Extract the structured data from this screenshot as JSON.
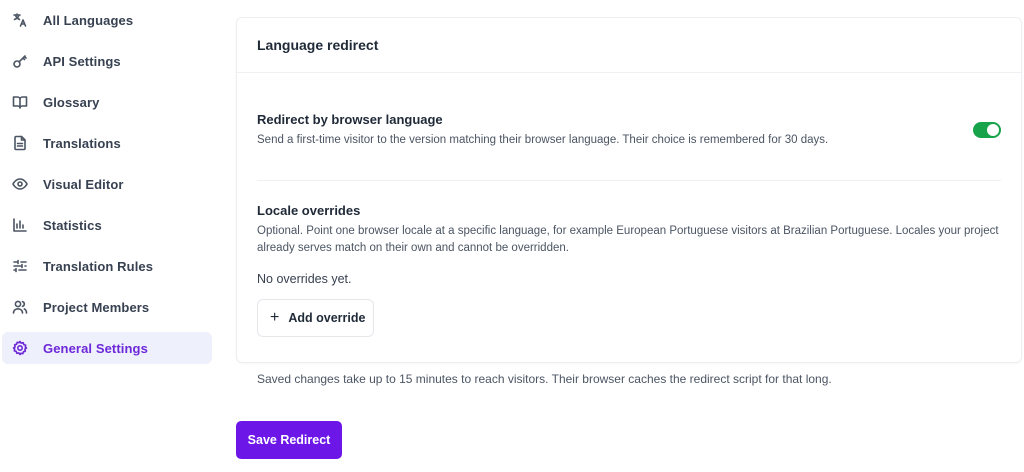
{
  "sidebar": {
    "items": [
      {
        "label": "All Languages",
        "icon": "translate-icon"
      },
      {
        "label": "API Settings",
        "icon": "key-icon"
      },
      {
        "label": "Glossary",
        "icon": "book-icon"
      },
      {
        "label": "Translations",
        "icon": "document-icon"
      },
      {
        "label": "Visual Editor",
        "icon": "eye-icon"
      },
      {
        "label": "Statistics",
        "icon": "bar-chart-icon"
      },
      {
        "label": "Translation Rules",
        "icon": "sliders-icon"
      },
      {
        "label": "Project Members",
        "icon": "users-icon"
      },
      {
        "label": "General Settings",
        "icon": "gear-icon",
        "active": true
      }
    ]
  },
  "card": {
    "title": "Language redirect",
    "redirect": {
      "title": "Redirect by browser language",
      "description": "Send a first-time visitor to the version matching their browser language. Their choice is remembered for 30 days.",
      "enabled": true
    },
    "overrides": {
      "title": "Locale overrides",
      "description": "Optional. Point one browser locale at a specific language, for example European Portuguese visitors at Brazilian Portuguese. Locales your project already serves match on their own and cannot be overridden.",
      "empty_text": "No overrides yet.",
      "add_label": "Add override"
    }
  },
  "note": "Saved changes take up to 15 minutes to reach visitors. Their browser caches the redirect script for that long.",
  "save_label": "Save Redirect",
  "colors": {
    "accent": "#6d16e8",
    "toggle_on": "#16a34a",
    "active_bg": "#eef0fb",
    "active_text": "#6d28d9"
  }
}
